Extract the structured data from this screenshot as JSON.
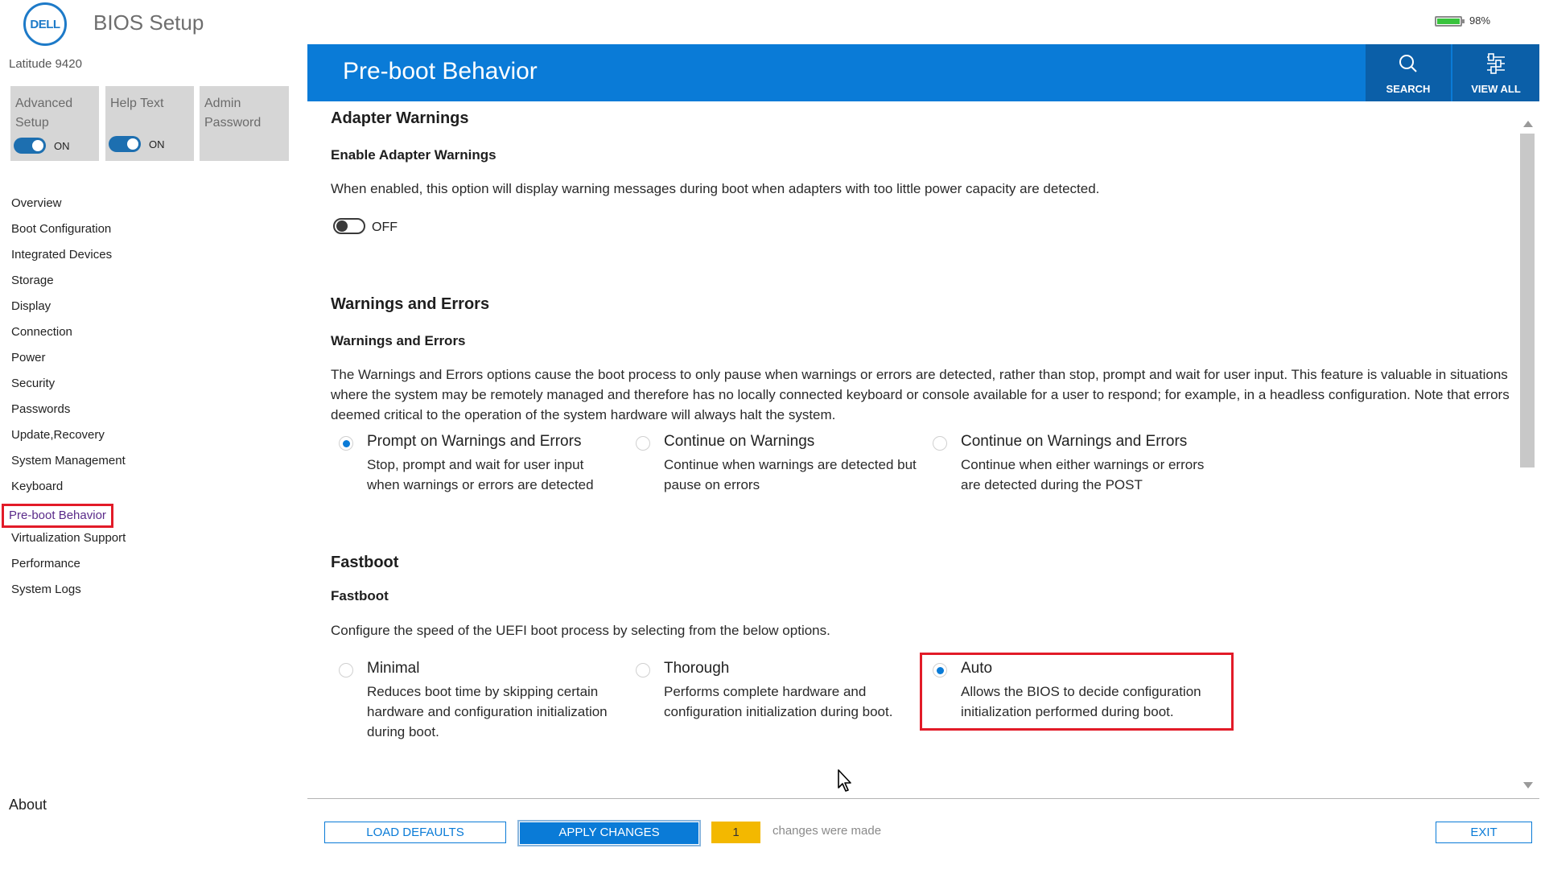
{
  "app": {
    "logo_text": "DELL",
    "title": "BIOS Setup",
    "battery_pct": "98%"
  },
  "sidebar": {
    "device_name": "Latitude 9420",
    "tiles": [
      {
        "label_line1": "Advanced",
        "label_line2": "Setup",
        "toggle_state": "ON"
      },
      {
        "label_line1": "Help Text",
        "label_line2": "",
        "toggle_state": "ON"
      },
      {
        "label_line1": "Admin",
        "label_line2": "Password",
        "toggle_state": ""
      }
    ],
    "nav": [
      "Overview",
      "Boot Configuration",
      "Integrated Devices",
      "Storage",
      "Display",
      "Connection",
      "Power",
      "Security",
      "Passwords",
      "Update,Recovery",
      "System Management",
      "Keyboard",
      "Pre-boot Behavior",
      "Virtualization Support",
      "Performance",
      "System Logs"
    ],
    "active_item": "Pre-boot Behavior",
    "about": "About"
  },
  "header": {
    "title": "Pre-boot Behavior",
    "search_label": "SEARCH",
    "view_all_label": "VIEW ALL"
  },
  "sections": {
    "adapter": {
      "title": "Adapter Warnings",
      "setting": "Enable Adapter Warnings",
      "description": "When enabled, this option will display warning messages during boot when adapters with too little power capacity are detected.",
      "toggle_state": "OFF"
    },
    "warnings": {
      "title": "Warnings and Errors",
      "setting": "Warnings and Errors",
      "description": "The Warnings and Errors options cause the boot process to only pause when warnings or errors are detected, rather than stop, prompt and wait for user input.  This feature is valuable in situations where the system may be remotely managed and therefore has no locally connected keyboard or console available for a user to respond; for example, in a headless configuration. Note that errors deemed critical to the operation of the system hardware will always halt the system.",
      "options": [
        {
          "label": "Prompt on Warnings and Errors",
          "desc": "Stop, prompt and wait for user input when warnings or errors are detected",
          "selected": true
        },
        {
          "label": "Continue on Warnings",
          "desc": "Continue when warnings are detected but pause on errors",
          "selected": false
        },
        {
          "label": "Continue on Warnings and Errors",
          "desc": "Continue when either warnings or errors are detected during the POST",
          "selected": false
        }
      ]
    },
    "fastboot": {
      "title": "Fastboot",
      "setting": "Fastboot",
      "description": "Configure the speed of the UEFI boot process by selecting from the below options.",
      "options": [
        {
          "label": "Minimal",
          "desc": "Reduces boot time by skipping certain hardware and configuration initialization during boot.",
          "selected": false
        },
        {
          "label": "Thorough",
          "desc": "Performs complete hardware and configuration initialization during boot.",
          "selected": false
        },
        {
          "label": "Auto",
          "desc": "Allows the BIOS to decide configuration initialization performed during boot.",
          "selected": true
        }
      ]
    }
  },
  "footer": {
    "load_defaults": "LOAD DEFAULTS",
    "apply_changes": "APPLY CHANGES",
    "change_count": "1",
    "changes_text": "changes were made",
    "exit": "EXIT"
  },
  "colors": {
    "accent": "#0a7bd7",
    "accent_dark": "#0b5fa8",
    "highlight": "#e21b28",
    "badge": "#f3b800"
  }
}
